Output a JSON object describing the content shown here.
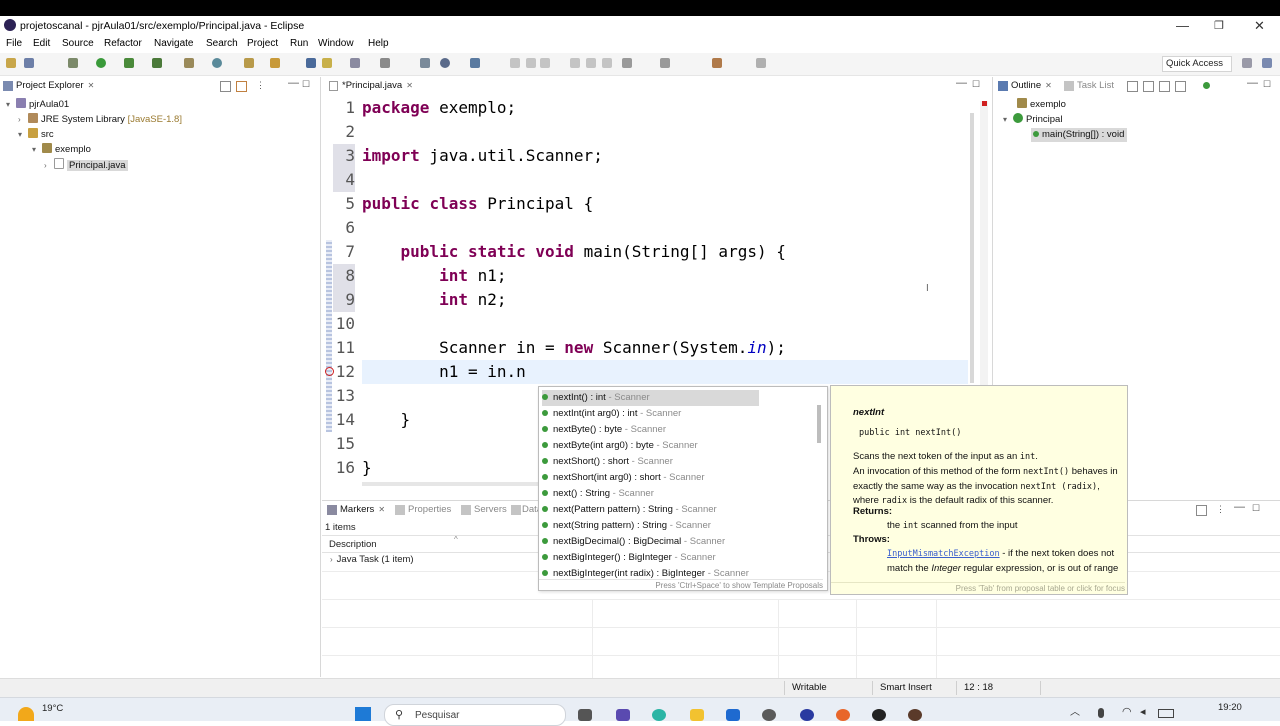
{
  "window": {
    "title": "projetoscanal - pjrAula01/src/exemplo/Principal.java - Eclipse"
  },
  "menu": [
    "File",
    "Edit",
    "Source",
    "Refactor",
    "Navigate",
    "Search",
    "Project",
    "Run",
    "Window",
    "Help"
  ],
  "toolbar": {
    "quick_access": "Quick Access"
  },
  "project_explorer": {
    "title": "Project Explorer",
    "tree": [
      {
        "label": "pjrAula01",
        "level": 0,
        "twisty": "▾",
        "icon": "project-icon"
      },
      {
        "label": "JRE System Library",
        "suffix": "[JavaSE-1.8]",
        "level": 1,
        "twisty": "›",
        "icon": "library-icon"
      },
      {
        "label": "src",
        "level": 1,
        "twisty": "▾",
        "icon": "source-folder-icon"
      },
      {
        "label": "exemplo",
        "level": 2,
        "twisty": "▾",
        "icon": "package-icon"
      },
      {
        "label": "Principal.java",
        "level": 3,
        "twisty": "›",
        "icon": "java-file-icon",
        "selected": true
      }
    ]
  },
  "editor": {
    "tab_label": "*Principal.java",
    "lines": [
      {
        "n": "1",
        "html": "<span class='kw'>package</span> exemplo;"
      },
      {
        "n": "2",
        "html": ""
      },
      {
        "n": "3",
        "html": "<span class='kw'>import</span> java.util.Scanner;"
      },
      {
        "n": "4",
        "html": ""
      },
      {
        "n": "5",
        "html": "<span class='kw'>public</span> <span class='kw'>class</span> Principal {"
      },
      {
        "n": "6",
        "html": ""
      },
      {
        "n": "7",
        "html": "    <span class='kw'>public</span> <span class='kw'>static</span> <span class='kw'>void</span> main(String[] args) {"
      },
      {
        "n": "8",
        "html": "        <span class='kw'>int</span> n1;"
      },
      {
        "n": "9",
        "html": "        <span class='kw'>int</span> n2;"
      },
      {
        "n": "10",
        "html": ""
      },
      {
        "n": "11",
        "html": "        Scanner in = <span class='kw'>new</span> Scanner(System.<span class='field'>in</span>);"
      },
      {
        "n": "12",
        "html": "        n1 = in.n"
      },
      {
        "n": "13",
        "html": ""
      },
      {
        "n": "14",
        "html": "    }"
      },
      {
        "n": "15",
        "html": ""
      },
      {
        "n": "16",
        "html": "}"
      }
    ]
  },
  "outline": {
    "title": "Outline",
    "task_list": "Task List",
    "items": [
      {
        "label": "exemplo",
        "icon": "package-icon"
      },
      {
        "label": "Principal",
        "icon": "class-icon"
      },
      {
        "label": "main(String[]) : void",
        "icon": "method-icon"
      }
    ]
  },
  "bottom_panel": {
    "tabs": [
      "Markers",
      "Properties",
      "Servers",
      "Data"
    ],
    "count": "1 items",
    "column": "Description",
    "row": "Java Task (1 item)"
  },
  "completion": {
    "proposals": [
      {
        "sig": "nextInt() : int",
        "type": " - Scanner"
      },
      {
        "sig": "nextInt(int arg0) : int",
        "type": " - Scanner"
      },
      {
        "sig": "nextByte() : byte",
        "type": " - Scanner"
      },
      {
        "sig": "nextByte(int arg0) : byte",
        "type": " - Scanner"
      },
      {
        "sig": "nextShort() : short",
        "type": " - Scanner"
      },
      {
        "sig": "nextShort(int arg0) : short",
        "type": " - Scanner"
      },
      {
        "sig": "next() : String",
        "type": " - Scanner"
      },
      {
        "sig": "next(Pattern pattern) : String",
        "type": " - Scanner"
      },
      {
        "sig": "next(String pattern) : String",
        "type": " - Scanner"
      },
      {
        "sig": "nextBigDecimal() : BigDecimal",
        "type": " - Scanner"
      },
      {
        "sig": "nextBigInteger() : BigInteger",
        "type": " - Scanner"
      },
      {
        "sig": "nextBigInteger(int radix) : BigInteger",
        "type": " - Scanner"
      }
    ],
    "footer": "Press 'Ctrl+Space' to show Template Proposals"
  },
  "javadoc": {
    "name": "nextInt",
    "signature": "public int nextInt()",
    "desc1_a": "Scans the next token of the input as an ",
    "desc1_code": "int",
    "desc1_b": ".",
    "desc2_a": "An invocation of this method of the form ",
    "desc2_code1": "nextInt()",
    "desc2_b": " behaves in exactly the same way as the invocation ",
    "desc2_code2": "nextInt (radix)",
    "desc2_c": ", where ",
    "desc2_code3": "radix",
    "desc2_d": " is the default radix of this scanner.",
    "returns_label": "Returns:",
    "returns_a": "the ",
    "returns_code": "int",
    "returns_b": " scanned from the input",
    "throws_label": "Throws:",
    "throws_link": "InputMismatchException",
    "throws_a": " - if the next token does not match the ",
    "throws_it": "Integer",
    "throws_b": " regular expression, or is out of range",
    "footer": "Press 'Tab' from proposal table or click for focus"
  },
  "status": {
    "writable": "Writable",
    "insert_mode": "Smart Insert",
    "position": "12 : 18"
  },
  "taskbar": {
    "weather": "19°C",
    "search_placeholder": "Pesquisar",
    "time": "19:20"
  }
}
